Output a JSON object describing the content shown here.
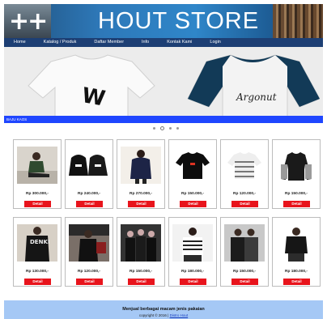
{
  "header": {
    "logo_text": "++",
    "title": "HOUT STORE"
  },
  "nav": [
    {
      "label": "Home"
    },
    {
      "label": "Katalog / Produk"
    },
    {
      "label": "Daftar Member"
    },
    {
      "label": "Info"
    },
    {
      "label": "Kontak Kami"
    },
    {
      "label": "Login"
    }
  ],
  "hero": {
    "caption": "BAJU KAOS",
    "shirt1_letter": "W",
    "shirt2_script": "Argonut"
  },
  "slider": {
    "count": 4,
    "active_index": 1
  },
  "products": [
    {
      "price": "Rp 300.000,-",
      "button": "Detail",
      "img": "person-sitting"
    },
    {
      "price": "Rp 240.000,-",
      "button": "Detail",
      "img": "black-hoodies"
    },
    {
      "price": "Rp 270.000,-",
      "button": "Detail",
      "img": "navy-hoodie-woman"
    },
    {
      "price": "Rp 150.000,-",
      "button": "Detail",
      "img": "black-tshirt"
    },
    {
      "price": "Rp 120.000,-",
      "button": "Detail",
      "img": "striped-tshirt"
    },
    {
      "price": "Rp 150.000,-",
      "button": "Detail",
      "img": "black-grey-longsleeve"
    },
    {
      "price": "Rp 130.000,-",
      "button": "Detail",
      "img": "black-print-tee"
    },
    {
      "price": "Rp 120.000,-",
      "button": "Detail",
      "img": "man-dark-outfit"
    },
    {
      "price": "Rp 150.000,-",
      "button": "Detail",
      "img": "group-streetwear"
    },
    {
      "price": "Rp 180.000,-",
      "button": "Detail",
      "img": "striped-shirt-woman"
    },
    {
      "price": "Rp 150.000,-",
      "button": "Detail",
      "img": "couple-hoodies"
    },
    {
      "price": "Rp 180.000,-",
      "button": "Detail",
      "img": "man-black-shirt"
    }
  ],
  "footer": {
    "title": "Menjual berbagai macam jenis pakaian",
    "copyright": "copyright © 2016 |",
    "link": "Distro Hout"
  },
  "colors": {
    "nav_bg": "#1d3f74",
    "hero_bar": "#1f46ff",
    "button_red": "#e8141c",
    "footer_bg": "#a5c8f5"
  }
}
